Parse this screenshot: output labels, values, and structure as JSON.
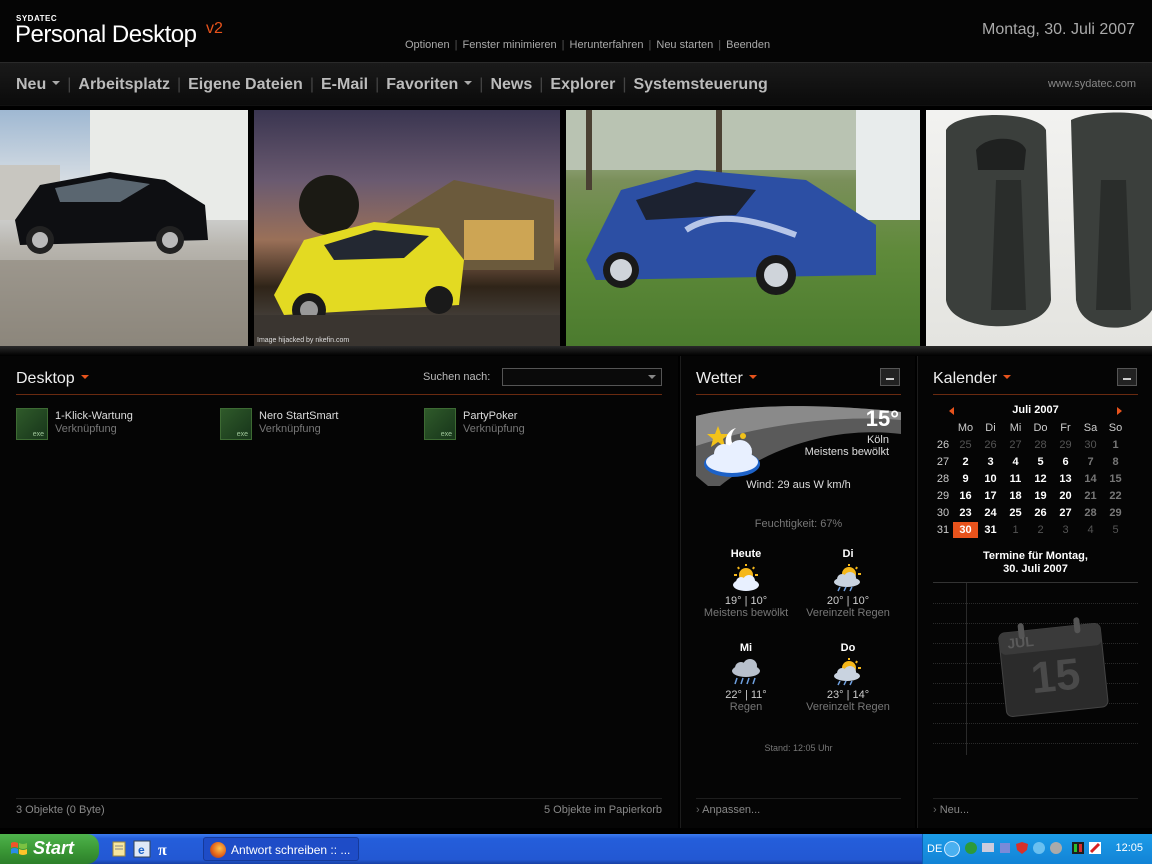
{
  "header": {
    "brand_small": "SYDATEC",
    "brand_main": "Personal Desktop",
    "brand_version": "v2",
    "date": "Montag, 30. Juli 2007",
    "menu": [
      "Optionen",
      "Fenster minimieren",
      "Herunterfahren",
      "Neu starten",
      "Beenden"
    ],
    "accent_color": "#e8531c"
  },
  "nav": {
    "items": [
      {
        "label": "Neu",
        "dropdown": true
      },
      {
        "label": "Arbeitsplatz",
        "dropdown": false
      },
      {
        "label": "Eigene Dateien",
        "dropdown": false
      },
      {
        "label": "E-Mail",
        "dropdown": false
      },
      {
        "label": "Favoriten",
        "dropdown": true
      },
      {
        "label": "News",
        "dropdown": false
      },
      {
        "label": "Explorer",
        "dropdown": false
      },
      {
        "label": "Systemsteuerung",
        "dropdown": false
      }
    ],
    "website": "www.sydatec.com"
  },
  "banner": {
    "watermark": "Image hijacked by nkefin.com"
  },
  "desktop_panel": {
    "title": "Desktop",
    "search_label": "Suchen nach:",
    "search_value": "",
    "shortcuts": [
      {
        "name": "1-Klick-Wartung",
        "type": "Verknüpfung",
        "icon": "exe-icon",
        "icon_text": "exe"
      },
      {
        "name": "Nero StartSmart",
        "type": "Verknüpfung",
        "icon": "exe-icon",
        "icon_text": "exe"
      },
      {
        "name": "PartyPoker",
        "type": "Verknüpfung",
        "icon": "exe-icon",
        "icon_text": "exe"
      }
    ],
    "footer_left": "3 Objekte (0 Byte)",
    "footer_right": "5 Objekte im Papierkorb"
  },
  "weather_panel": {
    "title": "Wetter",
    "current": {
      "temp": "15°",
      "city": "Köln",
      "condition": "Meistens bewölkt",
      "wind": "Wind: 29 aus W km/h",
      "humidity": "Feuchtigkeit: 67%"
    },
    "forecast": [
      {
        "day": "Heute",
        "temps": "19° | 10°",
        "condition": "Meistens bewölkt",
        "icon": "partly-sunny-icon"
      },
      {
        "day": "Di",
        "temps": "20° | 10°",
        "condition": "Vereinzelt Regen",
        "icon": "sun-rain-icon"
      },
      {
        "day": "Mi",
        "temps": "22° | 11°",
        "condition": "Regen",
        "icon": "rain-icon"
      },
      {
        "day": "Do",
        "temps": "23° | 14°",
        "condition": "Vereinzelt Regen",
        "icon": "sun-rain-icon"
      }
    ],
    "stand": "Stand: 12:05 Uhr",
    "footer": "Anpassen..."
  },
  "calendar_panel": {
    "title": "Kalender",
    "month": "Juli 2007",
    "weekdays": [
      "Mo",
      "Di",
      "Mi",
      "Do",
      "Fr",
      "Sa",
      "So"
    ],
    "weeks": [
      {
        "wk": "26",
        "days": [
          "25",
          "26",
          "27",
          "28",
          "29",
          "30",
          "1"
        ],
        "in": [
          false,
          false,
          false,
          false,
          false,
          false,
          true
        ]
      },
      {
        "wk": "27",
        "days": [
          "2",
          "3",
          "4",
          "5",
          "6",
          "7",
          "8"
        ],
        "in": [
          true,
          true,
          true,
          true,
          true,
          true,
          true
        ]
      },
      {
        "wk": "28",
        "days": [
          "9",
          "10",
          "11",
          "12",
          "13",
          "14",
          "15"
        ],
        "in": [
          true,
          true,
          true,
          true,
          true,
          true,
          true
        ]
      },
      {
        "wk": "29",
        "days": [
          "16",
          "17",
          "18",
          "19",
          "20",
          "21",
          "22"
        ],
        "in": [
          true,
          true,
          true,
          true,
          true,
          true,
          true
        ]
      },
      {
        "wk": "30",
        "days": [
          "23",
          "24",
          "25",
          "26",
          "27",
          "28",
          "29"
        ],
        "in": [
          true,
          true,
          true,
          true,
          true,
          true,
          true
        ]
      },
      {
        "wk": "31",
        "days": [
          "30",
          "31",
          "1",
          "2",
          "3",
          "4",
          "5"
        ],
        "in": [
          true,
          true,
          false,
          false,
          false,
          false,
          false
        ]
      }
    ],
    "today": "30",
    "appointments_title": "Termine für Montag,\n30. Juli 2007",
    "big_month": "JUL",
    "big_day": "15",
    "footer": "Neu..."
  },
  "taskbar": {
    "start_label": "Start",
    "quicklaunch_icons": [
      "notepad-icon",
      "internet-explorer-icon",
      "pi-icon"
    ],
    "task_label": "Antwort schreiben :: ...",
    "language": "DE",
    "clock": "12:05"
  }
}
